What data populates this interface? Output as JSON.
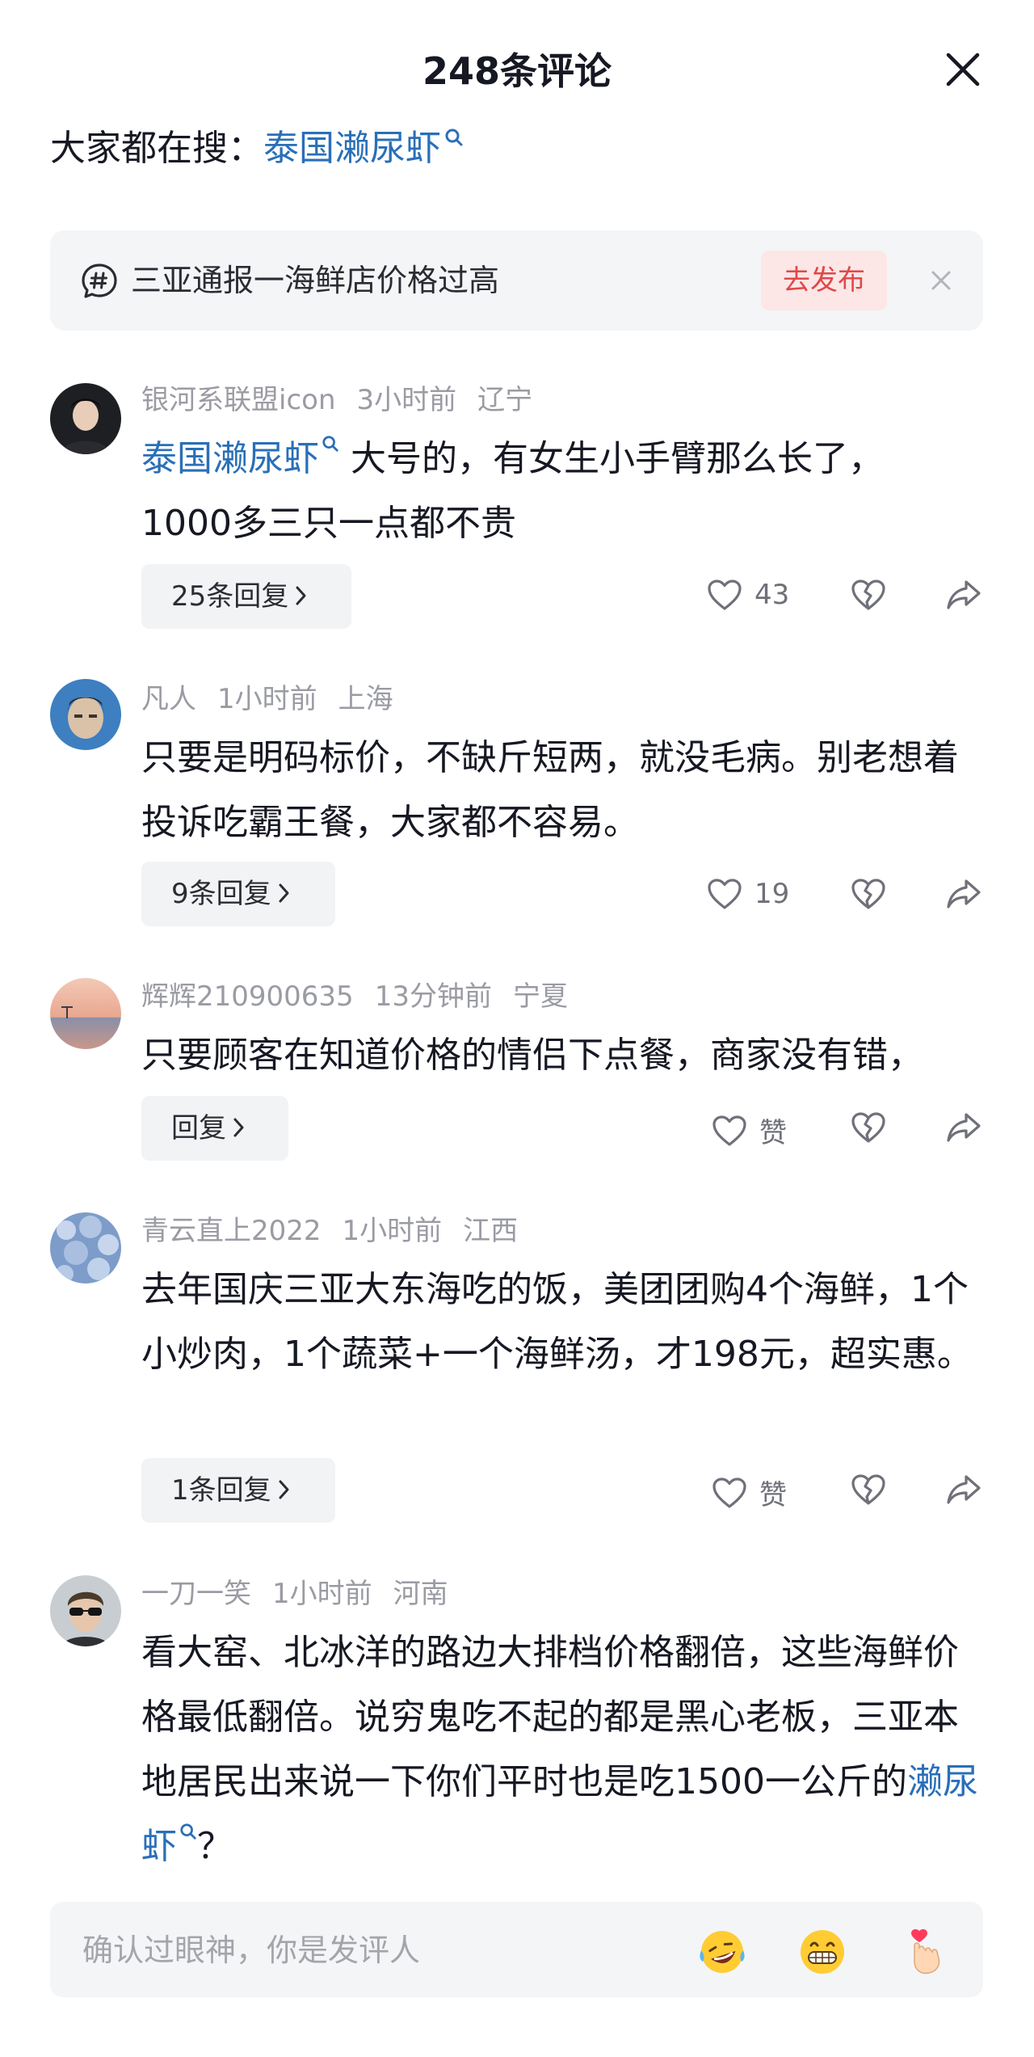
{
  "header": {
    "title": "248条评论"
  },
  "search": {
    "label": "大家都在搜：",
    "term": "泰国濑尿虾"
  },
  "topic": {
    "text": "三亚通报一海鲜店价格过高",
    "publish_label": "去发布"
  },
  "comments": [
    {
      "user": "银河系联盟icon",
      "time": "3小时前",
      "location": "辽宁",
      "keyword": "泰国濑尿虾",
      "text_line1": " 大号的，有女生小手臂那么长了，",
      "text_line2": "1000多三只一点都不贵",
      "reply_label": "25条回复",
      "likes": "43"
    },
    {
      "user": "凡人",
      "time": "1小时前",
      "location": "上海",
      "text": "只要是明码标价，不缺斤短两，就没毛病。别老想着投诉吃霸王餐，大家都不容易。",
      "reply_label": "9条回复",
      "likes": "19"
    },
    {
      "user": "辉辉210900635",
      "time": "13分钟前",
      "location": "宁夏",
      "text": "只要顾客在知道价格的情侣下点餐，商家没有错，",
      "reply_label": "回复",
      "likes": "赞"
    },
    {
      "user": "青云直上2022",
      "time": "1小时前",
      "location": "江西",
      "text": "去年国庆三亚大东海吃的饭，美团团购4个海鲜，1个小炒肉，1个蔬菜+一个海鲜汤，才198元，超实惠。",
      "reply_label": "1条回复",
      "likes": "赞"
    },
    {
      "user": "一刀一笑",
      "time": "1小时前",
      "location": "河南",
      "text": "看大窑、北冰洋的路边大排档价格翻倍，这些海鲜价格最低翻倍。说穷鬼吃不起的都是黑心老板，三亚本地居民出来说一下你们平时也是吃1500一公斤的",
      "keyword": "濑尿虾",
      "text_end": "？"
    }
  ],
  "input": {
    "placeholder": "确认过眼神，你是发评人"
  },
  "emojis": [
    "laughing-crying-emoji",
    "grinning-emoji",
    "finger-heart-emoji"
  ],
  "colors": {
    "link": "#2a6fb8",
    "publish_bg": "#fde6e6",
    "publish_text": "#e04848",
    "panel_bg": "#f4f5f7"
  }
}
